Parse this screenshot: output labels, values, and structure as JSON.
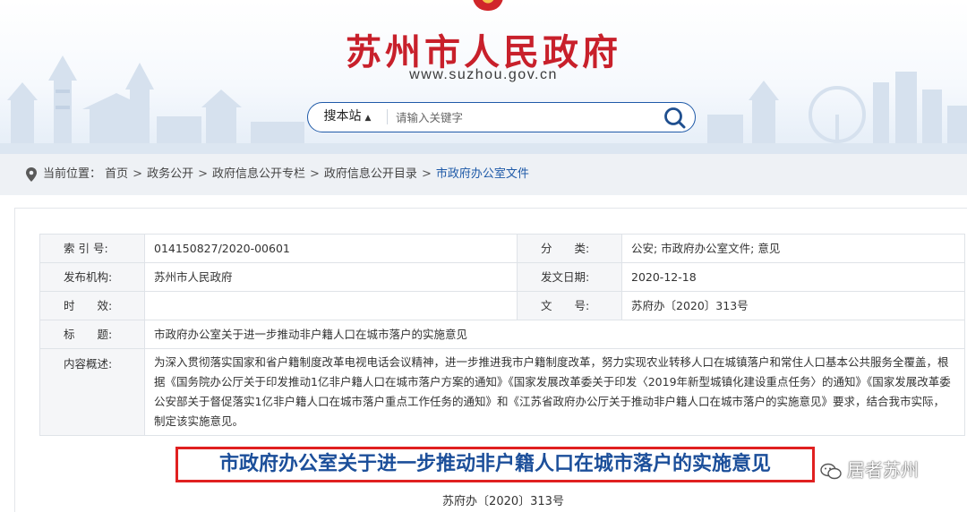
{
  "header": {
    "site_title": "苏州市人民政府",
    "site_url": "www.suzhou.gov.cn",
    "search": {
      "scope_label": "搜本站",
      "placeholder": "请输入关键字"
    }
  },
  "breadcrumb": {
    "prefix": "当前位置：",
    "items": [
      "首页",
      "政务公开",
      "政府信息公开专栏",
      "政府信息公开目录"
    ],
    "current": "市政府办公室文件"
  },
  "meta": {
    "index_label": "索 引 号:",
    "index_value": "014150827/2020-00601",
    "category_label": "分　　类:",
    "category_value": "公安; 市政府办公室文件; 意见",
    "publisher_label": "发布机构:",
    "publisher_value": "苏州市人民政府",
    "date_label": "发文日期:",
    "date_value": "2020-12-18",
    "validity_label": "时　　效:",
    "validity_value": "",
    "docno_label": "文　　号:",
    "docno_value": "苏府办〔2020〕313号",
    "title_label": "标　　题:",
    "title_value": "市政府办公室关于进一步推动非户籍人口在城市落户的实施意见",
    "summary_label": "内容概述:",
    "summary_value": "为深入贯彻落实国家和省户籍制度改革电视电话会议精神，进一步推进我市户籍制度改革，努力实现农业转移人口在城镇落户和常住人口基本公共服务全覆盖，根据《国务院办公厅关于印发推动1亿非户籍人口在城市落户方案的通知》《国家发展改革委关于印发〈2019年新型城镇化建设重点任务〉的通知》《国家发展改革委公安部关于督促落实1亿非户籍人口在城市落户重点工作任务的通知》和《江苏省政府办公厅关于推动非户籍人口在城市落户的实施意见》要求，结合我市实际，制定该实施意见。"
  },
  "article": {
    "title": "市政府办公室关于进一步推动非户籍人口在城市落户的实施意见",
    "doc_number": "苏府办〔2020〕313号"
  },
  "watermark": {
    "text": "居者苏州"
  },
  "colors": {
    "brand_red": "#c8202b",
    "link_blue": "#1f5aa8",
    "title_blue": "#1c4f9a",
    "highlight_red": "#e02020"
  }
}
